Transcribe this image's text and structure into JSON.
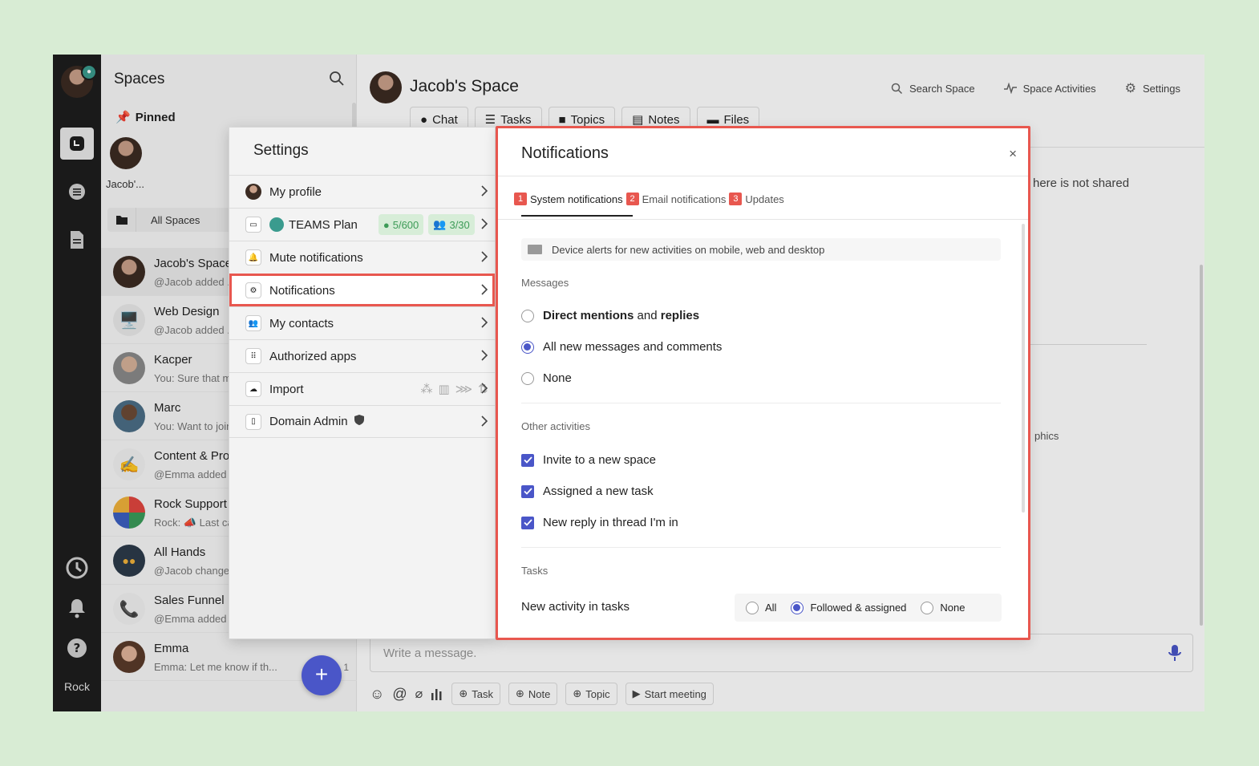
{
  "rail": {
    "label": "Rock"
  },
  "spaces": {
    "title": "Spaces",
    "pinned_label": "Pinned",
    "pinned_name": "Jacob'...",
    "filter_label": "All Spaces",
    "items": [
      {
        "name": "Jacob's Space",
        "preview": "@Jacob added ...",
        "count": ""
      },
      {
        "name": "Web Design",
        "preview": "@Jacob added ...",
        "count": ""
      },
      {
        "name": "Kacper",
        "preview": "You: Sure that make...",
        "count": ""
      },
      {
        "name": "Marc",
        "preview": "You: Want to join...",
        "count": ""
      },
      {
        "name": "Content & Production",
        "preview": "@Emma added ...",
        "count": ""
      },
      {
        "name": "Rock Support",
        "preview": "Rock: 📣 Last call...",
        "count": ""
      },
      {
        "name": "All Hands",
        "preview": "@Jacob changed...",
        "count": ""
      },
      {
        "name": "Sales Funnel",
        "preview": "@Emma added ...",
        "count": ""
      },
      {
        "name": "Emma",
        "preview": "Emma: Let me know if th...",
        "count": "1"
      }
    ]
  },
  "main": {
    "title": "Jacob's Space",
    "actions": {
      "search": "Search Space",
      "activities": "Space Activities",
      "settings": "Settings"
    },
    "tabs": [
      "Chat",
      "Tasks",
      "Topics",
      "Notes",
      "Files"
    ],
    "bg_text1": "here is not shared",
    "bg_text2": "phics",
    "composer_placeholder": "Write a message.",
    "tools": {
      "task": "Task",
      "note": "Note",
      "topic": "Topic",
      "meeting": "Start meeting"
    }
  },
  "settings": {
    "title": "Settings",
    "items": {
      "profile": "My profile",
      "plan": "TEAMS Plan",
      "plan_storage": "5/600",
      "plan_members": "3/30",
      "mute": "Mute notifications",
      "notifications": "Notifications",
      "contacts": "My contacts",
      "apps": "Authorized apps",
      "import": "Import",
      "domain": "Domain Admin"
    }
  },
  "notifications": {
    "title": "Notifications",
    "close": "×",
    "tabs": [
      {
        "num": "1",
        "label": "System notifications"
      },
      {
        "num": "2",
        "label": "Email notifications"
      },
      {
        "num": "3",
        "label": "Updates"
      }
    ],
    "alert": "Device alerts for new activities on mobile, web and desktop",
    "messages_label": "Messages",
    "msg_opt1_a": "Direct mentions",
    "msg_opt1_b": "and",
    "msg_opt1_c": "replies",
    "msg_opt2": "All new messages and comments",
    "msg_opt3": "None",
    "msg_selected": "All new messages and comments",
    "other_label": "Other activities",
    "other_opts": [
      "Invite to a new space",
      "Assigned a new task",
      "New reply in thread I'm in"
    ],
    "tasks_label": "Tasks",
    "task_row": "New activity in tasks",
    "task_opts": [
      "All",
      "Followed & assigned",
      "None"
    ],
    "task_selected": "Followed & assigned"
  },
  "colors": {
    "accent": "#4a56c8",
    "highlight": "#e8574f",
    "plan_badge": "#3d9b57"
  }
}
